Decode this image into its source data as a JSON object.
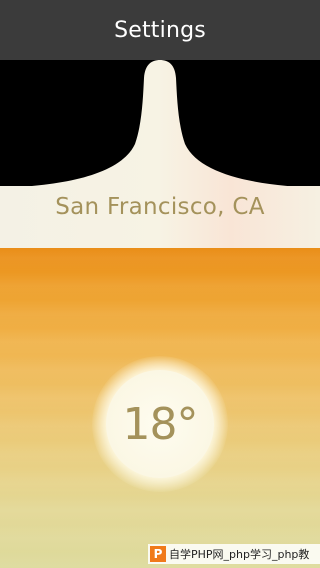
{
  "navbar": {
    "title": "Settings"
  },
  "location": {
    "label": "San Francisco, CA"
  },
  "weather": {
    "temperature": "18°"
  },
  "watermark": {
    "logo_letter": "P",
    "text": "自学PHP网_php学习_php教"
  },
  "colors": {
    "navbar_bg": "#3b3b3b",
    "accent_text": "#a4925b",
    "gradient_top": "#e98a12",
    "gradient_bottom": "#ddda9c",
    "cream": "#f6f2e4"
  }
}
